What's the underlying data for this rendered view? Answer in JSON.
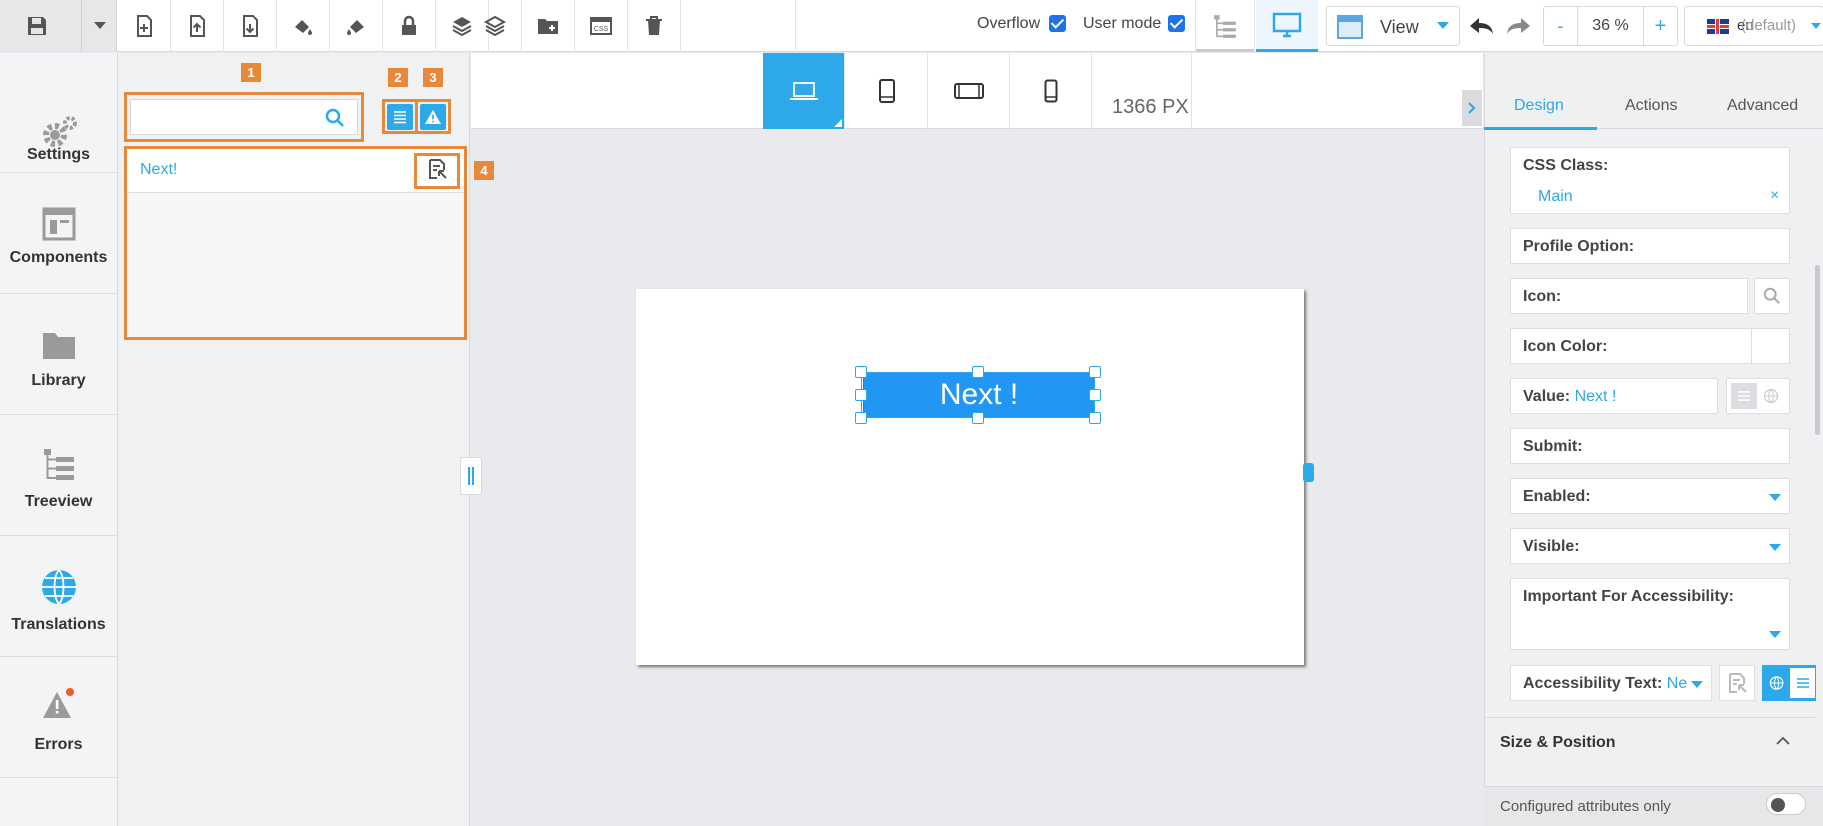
{
  "toolbar": {
    "overflow_label": "Overflow",
    "user_mode_label": "User mode",
    "view_label": "View",
    "zoom_minus": "-",
    "zoom_value": "36 %",
    "zoom_plus": "+",
    "language_code": "en",
    "language_default": "(default)"
  },
  "leftnav": {
    "items": [
      {
        "label": "Settings",
        "icon": "gears-icon"
      },
      {
        "label": "Components",
        "icon": "components-icon"
      },
      {
        "label": "Library",
        "icon": "folder-icon"
      },
      {
        "label": "Treeview",
        "icon": "treeview-icon"
      },
      {
        "label": "Translations",
        "icon": "globe-icon"
      },
      {
        "label": "Errors",
        "icon": "warning-icon"
      }
    ]
  },
  "translations": {
    "search_placeholder": "",
    "badges": [
      "1",
      "2",
      "3",
      "4"
    ],
    "rows": [
      {
        "text": "Next!"
      }
    ]
  },
  "canvas": {
    "width_value": "1366",
    "width_unit": "PX",
    "button_text": "Next !"
  },
  "properties": {
    "tabs": [
      "Design",
      "Actions",
      "Advanced"
    ],
    "css_class_label": "CSS Class:",
    "css_class_value": "Main",
    "css_class_clear": "×",
    "profile_option_label": "Profile Option:",
    "icon_label": "Icon:",
    "icon_color_label": "Icon Color:",
    "value_label": "Value:",
    "value_value": "Next !",
    "submit_label": "Submit:",
    "enabled_label": "Enabled:",
    "visible_label": "Visible:",
    "accessibility_important_label": "Important For Accessibility:",
    "accessibility_text_label": "Accessibility Text:",
    "accessibility_text_value": "Ne",
    "size_position_label": "Size & Position",
    "configured_only_label": "Configured attributes only"
  },
  "colors": {
    "accent": "#2da8e8",
    "highlight": "#e8893a",
    "button": "#2196f3"
  }
}
